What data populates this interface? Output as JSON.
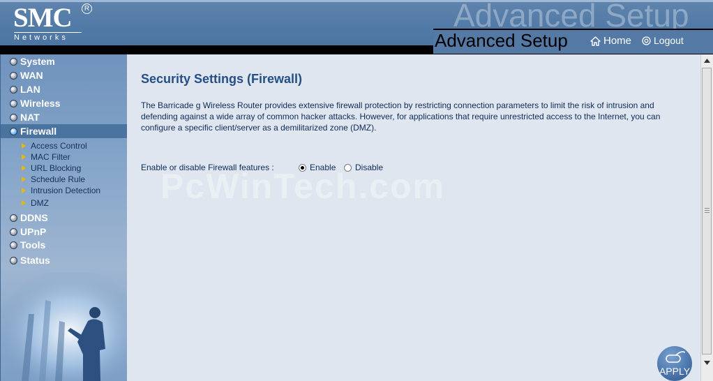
{
  "header": {
    "brand": "SMC",
    "brand_mark": "R",
    "brand_sub": "Networks",
    "watermark": "Advanced Setup",
    "title": "Advanced Setup",
    "home_label": "Home",
    "logout_label": "Logout"
  },
  "sidebar": {
    "items": [
      {
        "label": "System",
        "active": false
      },
      {
        "label": "WAN",
        "active": false
      },
      {
        "label": "LAN",
        "active": false
      },
      {
        "label": "Wireless",
        "active": false
      },
      {
        "label": "NAT",
        "active": false
      },
      {
        "label": "Firewall",
        "active": true
      },
      {
        "label": "DDNS",
        "active": false
      },
      {
        "label": "UPnP",
        "active": false
      },
      {
        "label": "Tools",
        "active": false
      },
      {
        "label": "Status",
        "active": false
      }
    ],
    "firewall_subitems": [
      "Access Control",
      "MAC Filter",
      "URL Blocking",
      "Schedule Rule",
      "Intrusion Detection",
      "DMZ"
    ]
  },
  "main": {
    "title": "Security Settings (Firewall)",
    "description": "The Barricade g Wireless Router provides extensive firewall protection by restricting connection parameters to limit the risk of intrusion and defending against a wide array of common hacker attacks. However, for applications that require unrestricted access to the Internet, you can configure a specific client/server as a demilitarized zone (DMZ).",
    "firewall_label": "Enable or disable Firewall features :",
    "option_enable": "Enable",
    "option_disable": "Disable",
    "selected_option": "Enable",
    "watermark": "PcWinTech.com",
    "apply_label": "APPLY"
  },
  "colors": {
    "header_bg": "#5079a6",
    "main_bg": "#dfe6ef",
    "title_color": "#234f86",
    "active_menu_bg": "#4b739f"
  },
  "icons": {
    "home": "home-icon",
    "logout": "power-icon",
    "apply": "apply-icon"
  }
}
